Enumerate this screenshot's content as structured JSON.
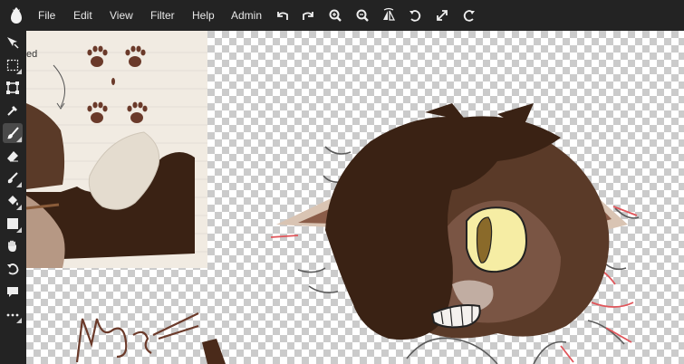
{
  "menu": {
    "file": "File",
    "edit": "Edit",
    "view": "View",
    "filter": "Filter",
    "help": "Help",
    "admin": "Admin"
  },
  "toolbar_icons": [
    "undo-icon",
    "redo-icon",
    "zoom-in-icon",
    "zoom-out-icon",
    "flip-icon",
    "rotate-ccw-icon",
    "fullscreen-icon",
    "rotate-cw-icon"
  ],
  "tools": [
    "move",
    "marquee-select",
    "transform",
    "eyedropper",
    "brush",
    "eraser",
    "smudge",
    "paint-bucket",
    "shape",
    "hand",
    "undo-history",
    "comment",
    "more"
  ],
  "active_tool": "brush",
  "reference": {
    "partial_text": "ed"
  },
  "colors": {
    "ui_bg": "#232323",
    "active_tool": "#4a4a4a",
    "fur_dark": "#3a2214",
    "fur_mid": "#5a3a28",
    "ear_light": "#d9c4b3",
    "eye": "#f6eda4",
    "sketch_red": "#e0555a"
  }
}
